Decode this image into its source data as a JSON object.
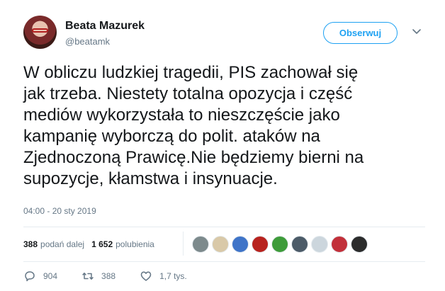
{
  "author": {
    "name": "Beata Mazurek",
    "handle": "@beatamk"
  },
  "follow_button": {
    "label": "Obserwuj"
  },
  "tweet": {
    "text": "W obliczu ludzkiej tragedii, PIS zachował się\njak trzeba. Niestety totalna opozycja i część\nmediów wykorzystała to nieszczęście jako\nkampanię wyborczą do polit. ataków na\nZjednoczoną Prawicę.Nie będziemy bierni na\nsupozycje, kłamstwa i insynuacje.",
    "timestamp": "04:00 - 20 sty 2019"
  },
  "stats": {
    "retweets_count": "388",
    "retweets_label": "podań dalej",
    "likes_count": "1 652",
    "likes_label": "polubienia"
  },
  "likers": [
    {
      "color": "#7d8a8c"
    },
    {
      "color": "#d9c9a8"
    },
    {
      "color": "#3f74c8"
    },
    {
      "color": "#b8231e"
    },
    {
      "color": "#3e9c3a"
    },
    {
      "color": "#4c5b68"
    },
    {
      "color": "#ccd6dd"
    },
    {
      "color": "#c2303a"
    },
    {
      "color": "#2c2c2c"
    }
  ],
  "actions": {
    "reply_count": "904",
    "retweet_count": "388",
    "like_count": "1,7 tys."
  },
  "colors": {
    "accent": "#1da1f2",
    "secondary_text": "#657786",
    "primary_text": "#14171a"
  }
}
